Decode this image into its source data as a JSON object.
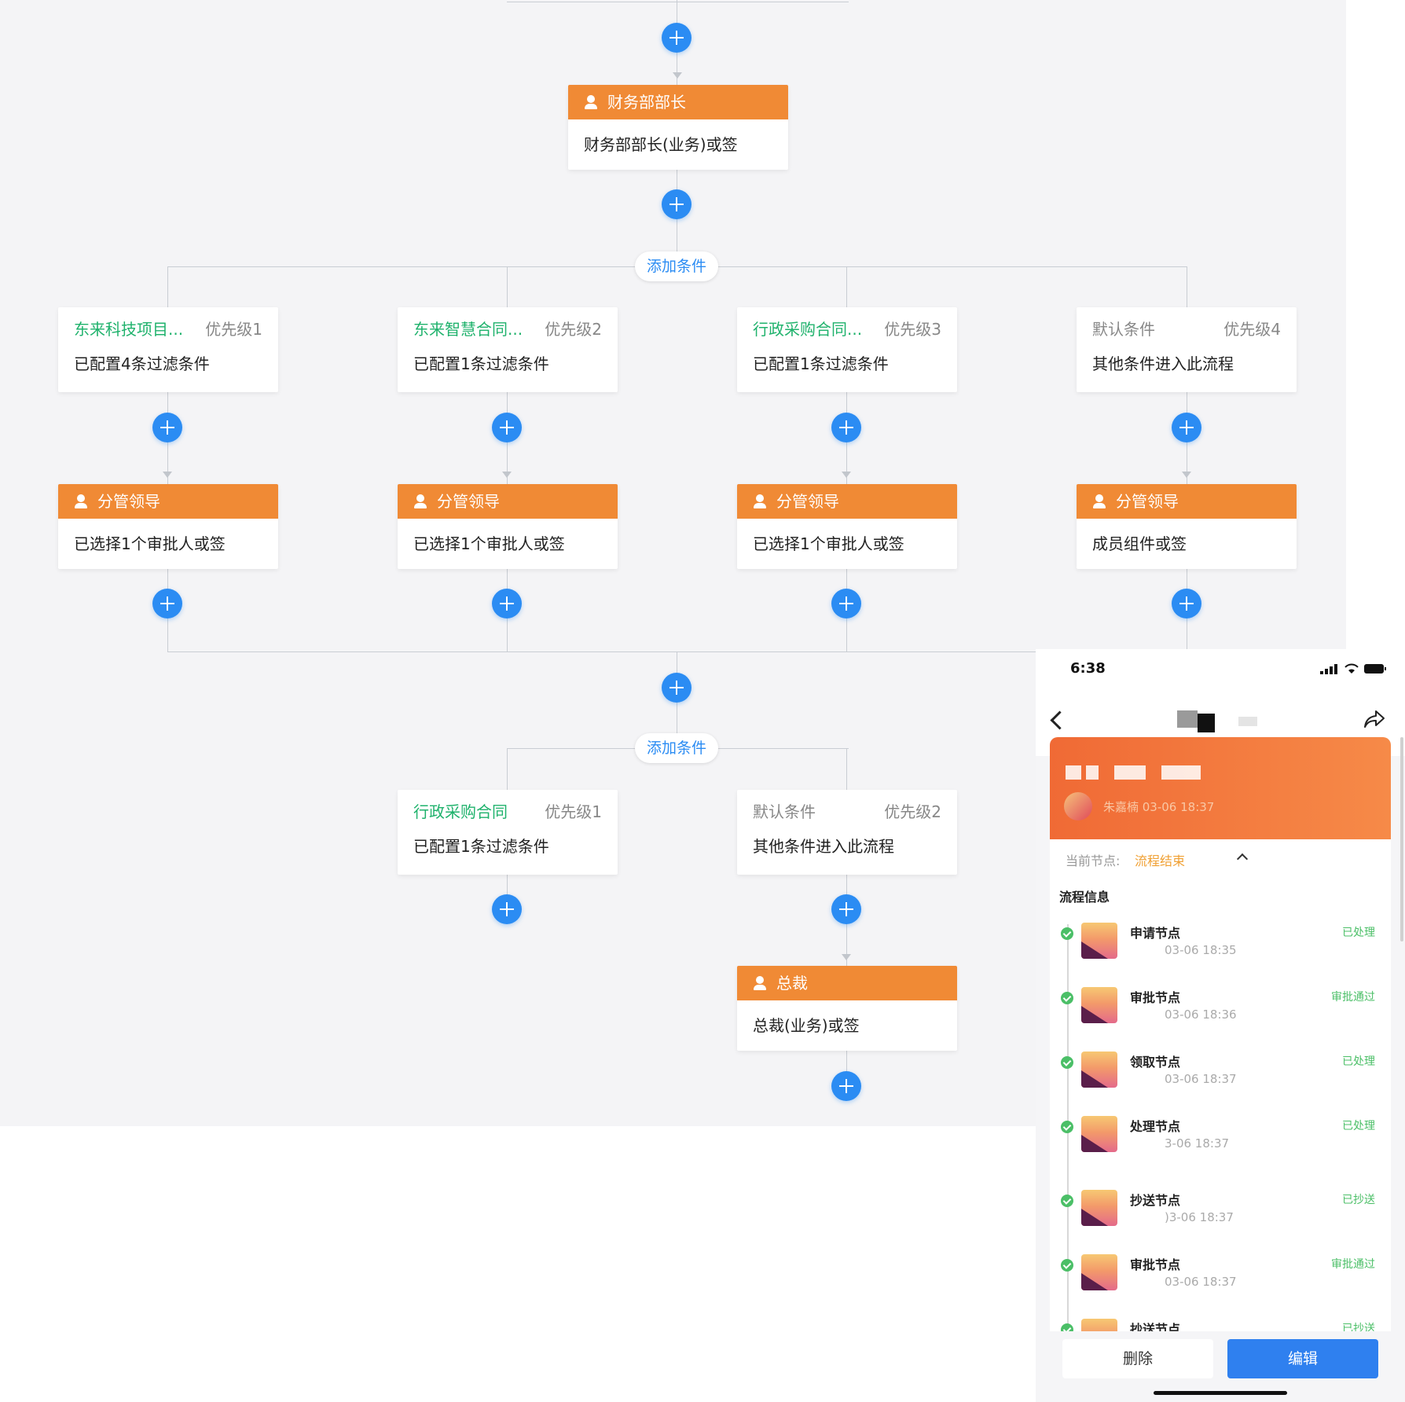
{
  "flow": {
    "top_approver": {
      "title": "财务部部长",
      "desc": "财务部部长(业务)或签"
    },
    "add_condition_label": "添加条件",
    "branches_1": [
      {
        "name": "东来科技项目...",
        "priority": "优先级1",
        "summary": "已配置4条过滤条件",
        "default": false,
        "approver": {
          "title": "分管领导",
          "desc": "已选择1个审批人或签"
        }
      },
      {
        "name": "东来智慧合同...",
        "priority": "优先级2",
        "summary": "已配置1条过滤条件",
        "default": false,
        "approver": {
          "title": "分管领导",
          "desc": "已选择1个审批人或签"
        }
      },
      {
        "name": "行政采购合同...",
        "priority": "优先级3",
        "summary": "已配置1条过滤条件",
        "default": false,
        "approver": {
          "title": "分管领导",
          "desc": "已选择1个审批人或签"
        }
      },
      {
        "name": "默认条件",
        "priority": "优先级4",
        "summary": "其他条件进入此流程",
        "default": true,
        "approver": {
          "title": "分管领导",
          "desc": "成员组件或签"
        }
      }
    ],
    "branches_2": [
      {
        "name": "行政采购合同",
        "priority": "优先级1",
        "summary": "已配置1条过滤条件",
        "default": false
      },
      {
        "name": "默认条件",
        "priority": "优先级2",
        "summary": "其他条件进入此流程",
        "default": true,
        "approver": {
          "title": "总裁",
          "desc": "总裁(业务)或签"
        }
      }
    ]
  },
  "phone": {
    "time": "6:38",
    "banner_sub": "朱嘉楠  03-06 18:37",
    "current_node_label": "当前节点:",
    "current_node_value": "流程结束",
    "flow_info_title": "流程信息",
    "items": [
      {
        "name": "申请节点",
        "time": "03-06 18:35",
        "status": "已处理"
      },
      {
        "name": "审批节点",
        "time": "03-06 18:36",
        "status": "审批通过"
      },
      {
        "name": "领取节点",
        "time": "03-06 18:37",
        "status": "已处理"
      },
      {
        "name": "处理节点",
        "time": "3-06 18:37",
        "status": "已处理"
      },
      {
        "name": "抄送节点",
        "time": ")3-06 18:37",
        "status": "已抄送"
      },
      {
        "name": "审批节点",
        "time": "03-06 18:37",
        "status": "审批通过"
      },
      {
        "name": "抄送节点",
        "time": "",
        "status": "已抄送"
      }
    ],
    "delete_label": "删除",
    "edit_label": "编辑"
  },
  "colors": {
    "accent_blue": "#2b8cf3",
    "approver_orange": "#f08a35",
    "condition_green": "#1fb26c"
  }
}
